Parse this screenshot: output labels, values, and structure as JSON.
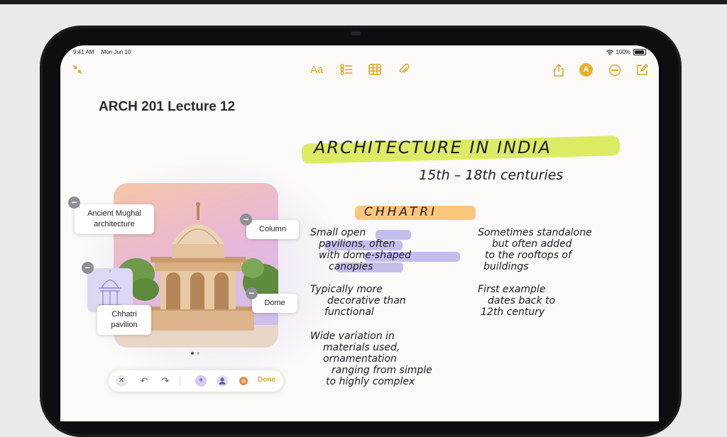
{
  "status_bar": {
    "time": "9:41 AM",
    "date": "Mon Jun 10",
    "battery": "100%"
  },
  "toolbar_icons": {
    "collapse": "arrows-in-icon",
    "format": "Aa",
    "checklist": "checklist-icon",
    "table": "table-icon",
    "attach": "paperclip-icon",
    "share": "share-icon",
    "markup": "A",
    "more": "ellipsis-icon",
    "compose": "compose-icon"
  },
  "note": {
    "title": "ARCH 201 Lecture 12"
  },
  "image_labels": {
    "ancient_mughal": [
      "Ancient Mughal",
      "architecture"
    ],
    "column": "Column",
    "dome": "Dome",
    "chhatri_pavilion": [
      "Chhatri",
      "pavilion"
    ]
  },
  "image_toolbar": {
    "done_label": "Done"
  },
  "handwriting": {
    "heading": "ARCHITECTURE IN INDIA",
    "centuries": "15th – 18th centuries",
    "section": "CHHATRI",
    "bullets_left": [
      [
        "Small open",
        "pavilions, often",
        "with dome-shaped",
        "canopies"
      ],
      [
        "Typically more",
        "decorative than",
        "functional"
      ],
      [
        "Wide variation in",
        "materials used,",
        "ornamentation",
        "ranging from simple",
        "to highly complex"
      ]
    ],
    "bullets_right": [
      [
        "Sometimes standalone",
        "but often added",
        "to the rooftops of",
        "buildings"
      ],
      [
        "First example",
        "dates back to",
        "12th century"
      ]
    ]
  },
  "colors": {
    "accent": "#d9a521",
    "highlight_yellow": "#d7e84a",
    "highlight_orange": "#f7ba5c",
    "highlight_purple": "#b0aae8"
  }
}
